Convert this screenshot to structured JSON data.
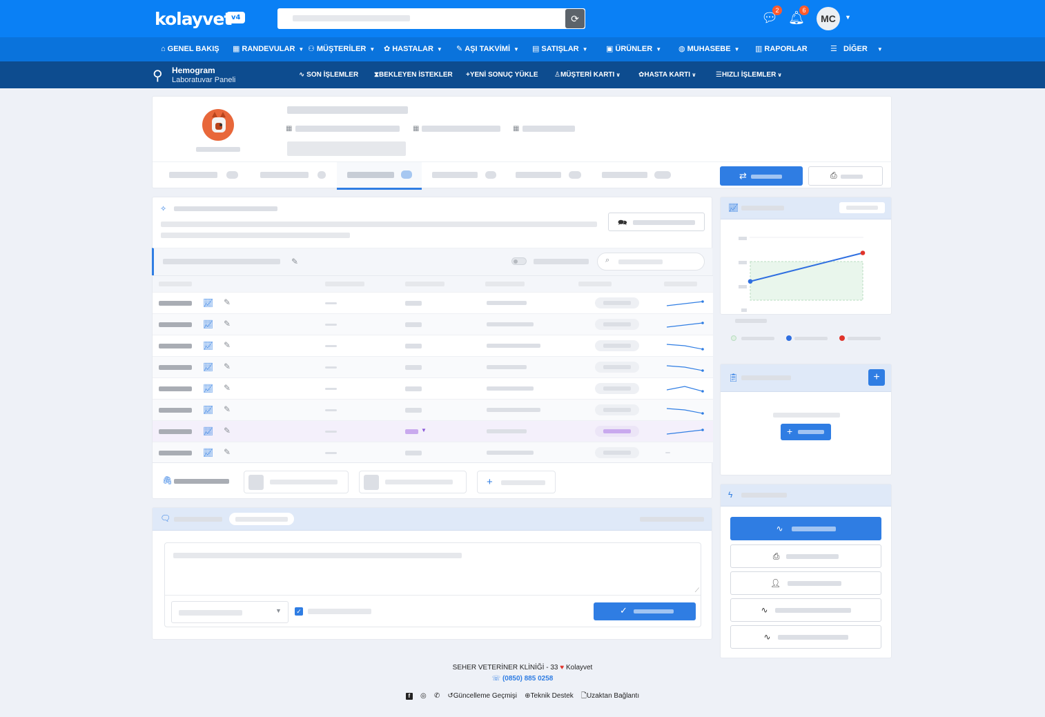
{
  "brand": {
    "logo_text": "kolayvet",
    "version": "v4"
  },
  "topbar": {
    "messages_icon": "chat-icon",
    "messages_count": "2",
    "notifications_icon": "bell-icon",
    "notifications_count": "6",
    "avatar_initials": "MC",
    "refresh_icon": "refresh-icon"
  },
  "nav": {
    "items": [
      {
        "label": "GENEL BAKIŞ",
        "icon": "home-icon",
        "glyph": "⌂"
      },
      {
        "label": "RANDEVULAR",
        "icon": "calendar-icon",
        "glyph": "▦"
      },
      {
        "label": "MÜŞTERİLER",
        "icon": "users-icon",
        "glyph": "⚇"
      },
      {
        "label": "HASTALAR",
        "icon": "paw-icon",
        "glyph": "✿"
      },
      {
        "label": "AŞI TAKVİMİ",
        "icon": "syringe-icon",
        "glyph": "✎"
      },
      {
        "label": "SATIŞLAR",
        "icon": "store-icon",
        "glyph": "▤"
      },
      {
        "label": "ÜRÜNLER",
        "icon": "boxes-icon",
        "glyph": "▣"
      },
      {
        "label": "MUHASEBE",
        "icon": "money-icon",
        "glyph": "◍"
      },
      {
        "label": "RAPORLAR",
        "icon": "chart-icon",
        "glyph": "▥"
      },
      {
        "label": "DİĞER",
        "icon": "menu-icon",
        "glyph": "☰"
      }
    ]
  },
  "subnav": {
    "title": "Hemogram",
    "subtitle": "Laboratuvar Paneli",
    "items": [
      {
        "label": "SON İŞLEMLER",
        "glyph": "∿"
      },
      {
        "label": "BEKLEYEN İSTEKLER",
        "glyph": "⧗"
      },
      {
        "label": "YENİ SONUÇ YÜKLE",
        "glyph": "+"
      },
      {
        "label": "MÜŞTERİ KARTI",
        "glyph": "♙"
      },
      {
        "label": "HASTA KARTI",
        "glyph": "✿"
      },
      {
        "label": "HIZLI İŞLEMLER",
        "glyph": "☰"
      }
    ]
  },
  "table": {
    "rows": [
      {
        "trend": "up"
      },
      {
        "trend": "up"
      },
      {
        "trend": "down"
      },
      {
        "trend": "down"
      },
      {
        "trend": "wave"
      },
      {
        "trend": "down"
      },
      {
        "trend": "up",
        "highlight": true
      },
      {
        "trend": "none"
      }
    ]
  },
  "chart_data": {
    "type": "line",
    "x": [
      0,
      1
    ],
    "values": [
      0.35,
      0.9
    ]
  },
  "footer": {
    "clinic": "SEHER VETERİNER KLİNİĞİ - 33",
    "brand": "Kolayvet",
    "phone": "(0850) 885 0258",
    "links": [
      "Güncelleme Geçmişi",
      "Teknik Destek",
      "Uzaktan Bağlantı"
    ]
  },
  "colors": {
    "primary": "#0a80f5",
    "nav": "#0a73dc",
    "subnav": "#0d4c8f",
    "accent": "#2f7de3",
    "badge": "#ff5b2e"
  }
}
